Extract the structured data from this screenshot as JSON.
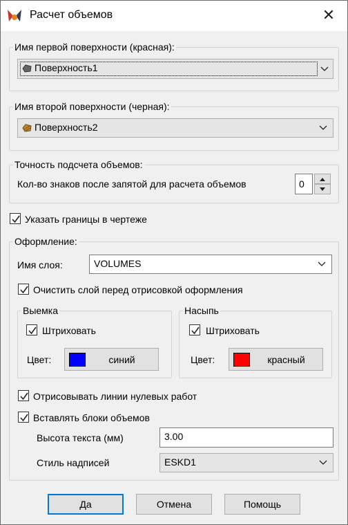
{
  "window": {
    "title": "Расчет объемов",
    "close_glyph": "✕"
  },
  "surface1": {
    "label": "Имя первой поверхности (красная):",
    "value": "Поверхность1"
  },
  "surface2": {
    "label": "Имя второй поверхности (черная):",
    "value": "Поверхность2"
  },
  "precision": {
    "label": "Точность подсчета объемов:",
    "digits_label": "Кол-во знаков после запятой для расчета объемов",
    "digits_value": "0"
  },
  "show_bounds": {
    "label": "Указать границы в чертеже",
    "checked": true
  },
  "design": {
    "label": "Оформление:",
    "layer_label": "Имя слоя:",
    "layer_value": "VOLUMES",
    "clear_layer_label": "Очистить слой перед  отрисовкой оформления",
    "cut": {
      "label": "Выемка",
      "hatch_label": "Штриховать",
      "color_label": "Цвет:",
      "color_name": "синий",
      "color_hex": "#0000ff"
    },
    "fill": {
      "label": "Насыпь",
      "hatch_label": "Штриховать",
      "color_label": "Цвет:",
      "color_name": "красный",
      "color_hex": "#ff0000"
    },
    "zero_lines_label": "Отрисовывать линии нулевых работ",
    "insert_blocks_label": "Вставлять блоки объемов",
    "text_height_label": "Высота текста (мм)",
    "text_height_value": "3.00",
    "label_style_label": "Стиль надписей",
    "label_style_value": "ESKD1"
  },
  "buttons": {
    "ok": "Да",
    "cancel": "Отмена",
    "help": "Помощь"
  },
  "colors": {
    "accent": "#0078d7",
    "face": "#f0f0f0"
  }
}
